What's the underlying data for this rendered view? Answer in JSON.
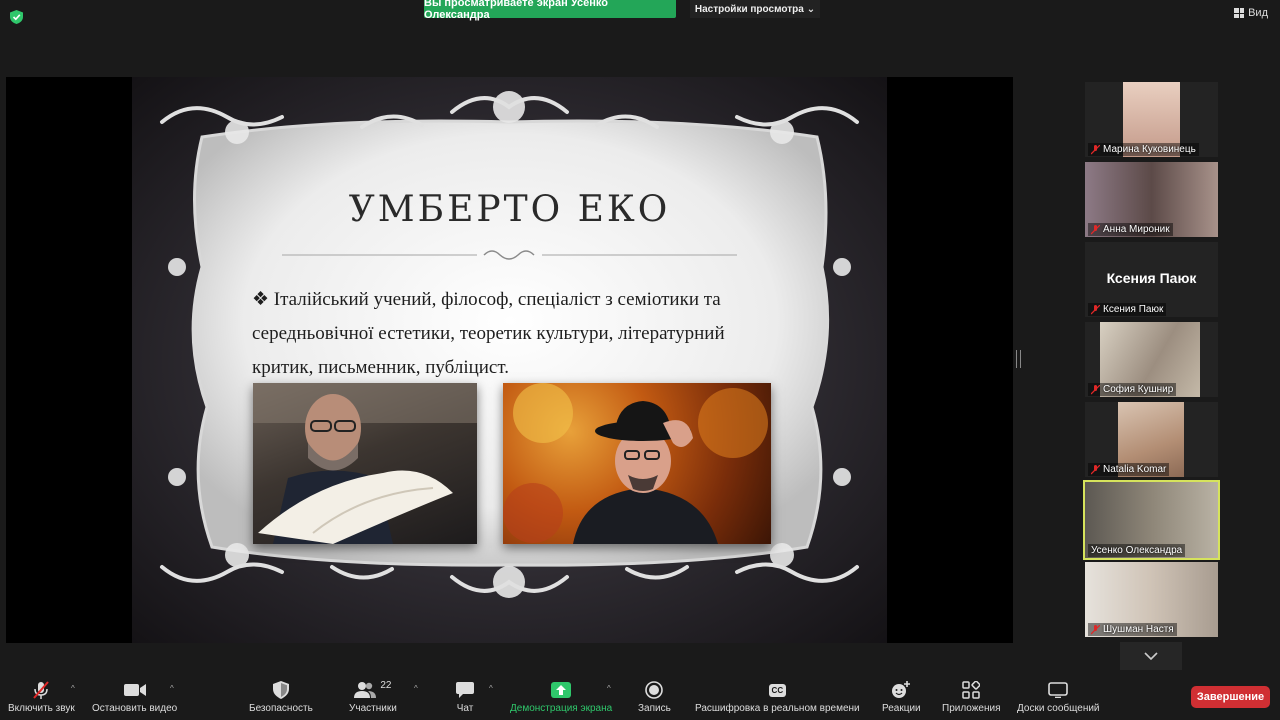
{
  "top": {
    "sharing_banner": "Вы просматриваете экран Усенко Олександра",
    "view_settings": "Настройки просмотра",
    "view_button": "Вид"
  },
  "slide": {
    "title": "УМБЕРТО ЕКО",
    "bullet": "❖",
    "text": "Італійський учений, філософ, спеціаліст з семіотики та середньовічної естетики, теоретик культури, літературний критик, письменник, публіцист."
  },
  "participants": [
    {
      "name": "Марина Куковинець",
      "video": true,
      "muted": true
    },
    {
      "name": "Анна Мироник",
      "video": true,
      "muted": true
    },
    {
      "name": "Ксения Паюк",
      "video": false,
      "label": "Ксения Паюк",
      "muted": true
    },
    {
      "name": "София Кушнир",
      "video": true,
      "muted": true
    },
    {
      "name": "Natalia Komar",
      "video": true,
      "muted": true
    },
    {
      "name": "Усенко Олександра",
      "video": true,
      "muted": false,
      "active": true
    },
    {
      "name": "Шушман Настя",
      "video": true,
      "muted": true
    }
  ],
  "toolbar": {
    "audio": "Включить звук",
    "video": "Остановить видео",
    "security": "Безопасность",
    "participants": "Участники",
    "participants_count": "22",
    "chat": "Чат",
    "share": "Демонстрация экрана",
    "record": "Запись",
    "captions": "Расшифровка в реальном времени",
    "captions_badge": "CC",
    "reactions": "Реакции",
    "apps": "Приложения",
    "whiteboards": "Доски сообщений",
    "end": "Завершение"
  },
  "colors": {
    "share_green": "#23a658",
    "active_border": "#d6e35c",
    "end_red": "#d02f33"
  }
}
